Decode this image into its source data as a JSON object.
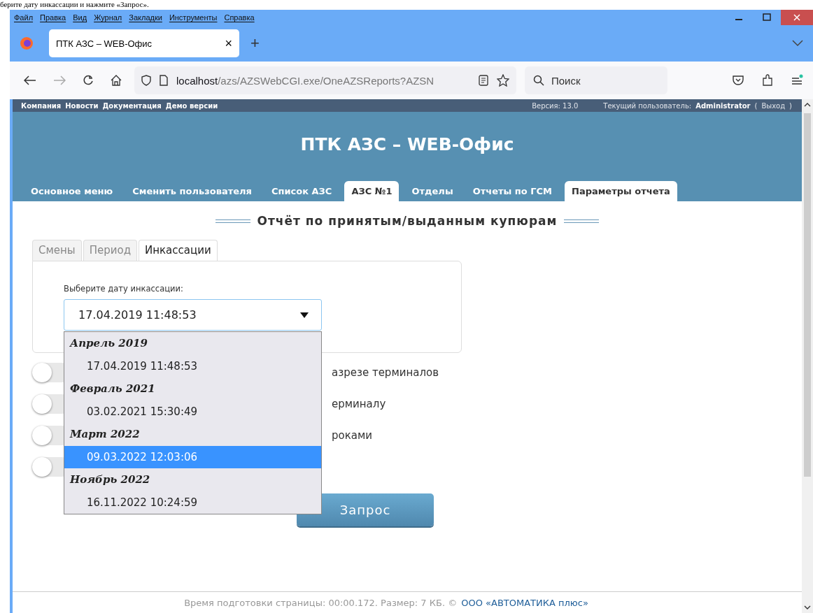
{
  "document_text": "берите дату инкассации и нажмите «Запрос».",
  "menu_bar": [
    {
      "label": "Файл"
    },
    {
      "label": "Правка"
    },
    {
      "label": "Вид"
    },
    {
      "label": "Журнал"
    },
    {
      "label": "Закладки"
    },
    {
      "label": "Инструменты"
    },
    {
      "label": "Справка"
    }
  ],
  "browser_tab": {
    "title": "ПТК АЗС – WEB-Офис",
    "close": "×",
    "new_tab": "+"
  },
  "address_bar": {
    "host": "localhost",
    "path": "/azs/AZSWebCGI.exe/OneAZSReports?AZSN"
  },
  "search": {
    "placeholder": "Поиск"
  },
  "top_bar": {
    "links": [
      "Компания",
      "Новости",
      "Документация",
      "Демо версии"
    ],
    "version": "Версия: 13.0",
    "user_label": "Текущий пользователь:",
    "user": "Administrator",
    "logout_open": "(",
    "logout": "Выход",
    "logout_close": ")"
  },
  "site_title": "ПТК АЗС – WEB-Офис",
  "nav_tabs": [
    {
      "label": "Основное меню",
      "selected": false
    },
    {
      "label": "Сменить пользователя",
      "selected": false
    },
    {
      "label": "Список АЗС",
      "selected": false
    },
    {
      "label": "АЗС №1",
      "selected": true
    },
    {
      "label": "Отделы",
      "selected": false
    },
    {
      "label": "Отчеты по ГСМ",
      "selected": false
    },
    {
      "label": "Параметры отчета",
      "selected": true
    }
  ],
  "report_title": "Отчёт по принятым/выданным купюрам",
  "report_tabs": [
    {
      "label": "Смены",
      "selected": false
    },
    {
      "label": "Период",
      "selected": false
    },
    {
      "label": "Инкассации",
      "selected": true
    }
  ],
  "field_label": "Выберите дату инкассации:",
  "date_select": {
    "value": "17.04.2019 11:48:53"
  },
  "dropdown": [
    {
      "group": "Апрель 2019",
      "options": [
        {
          "label": "17.04.2019 11:48:53",
          "selected": false
        }
      ]
    },
    {
      "group": "Февраль 2021",
      "options": [
        {
          "label": "03.02.2021 15:30:49",
          "selected": false
        }
      ]
    },
    {
      "group": "Март 2022",
      "options": [
        {
          "label": "09.03.2022 12:03:06",
          "selected": true
        }
      ]
    },
    {
      "group": "Ноябрь 2022",
      "options": [
        {
          "label": "16.11.2022 10:24:59",
          "selected": false
        }
      ]
    }
  ],
  "toggles": [
    {
      "on": false,
      "label": "азрезе терминалов"
    },
    {
      "on": false,
      "label": "ерминалу"
    },
    {
      "on": false,
      "label": "роками"
    },
    {
      "on": false
    }
  ],
  "submit": "Запрос",
  "footer": {
    "text": "Время подготовки страницы: 00:00.172. Размер: 7 КБ. ©",
    "link": "ООО «АВТОМАТИКА плюс»"
  }
}
